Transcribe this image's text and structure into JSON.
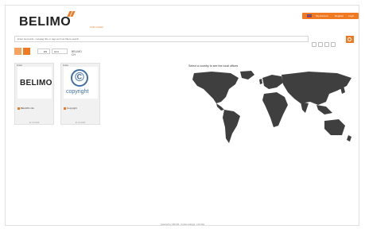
{
  "header": {
    "brand": "BELIMO",
    "cad_link": "CAD models",
    "topbar": {
      "account": "My Account",
      "register": "Register",
      "login": "Login"
    }
  },
  "search": {
    "placeholder": "Enter keywords, metatag title or tags and set filters search",
    "button_icon": "search-icon"
  },
  "toolbar": {
    "language": "EN",
    "view_select": "Grid",
    "breadcrumb": "BELIMO CH"
  },
  "folders": [
    {
      "tag": "Folder",
      "label": "BELIMO.info",
      "date": "01.01.2023"
    },
    {
      "tag": "Folder",
      "label": "Copyright",
      "date": "01.01.2023"
    }
  ],
  "copyright_word": "copyright",
  "map": {
    "title": "Select a country to see the local offices"
  },
  "footer": "powered by CELUM - Cookie settings - Info-Site",
  "colors": {
    "accent": "#f07a22",
    "map_land": "#3f3f3f"
  }
}
